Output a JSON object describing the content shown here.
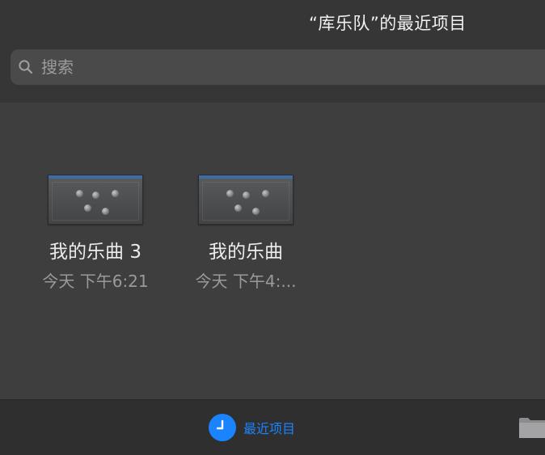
{
  "header": {
    "title": "“库乐队”的最近项目"
  },
  "search": {
    "placeholder": "搜索",
    "icon": "search-icon"
  },
  "files": [
    {
      "name": "我的乐曲 3",
      "date": "今天 下午6:21"
    },
    {
      "name": "我的乐曲",
      "date": "今天 下午4:..."
    }
  ],
  "tabbar": {
    "recent_label": "最近项目",
    "recent_icon": "clock-icon",
    "browse_icon": "folder-icon"
  },
  "colors": {
    "accent": "#1a84ff",
    "background": "#3e3e3f",
    "header": "#363637",
    "tabbar": "#2f2f30"
  }
}
